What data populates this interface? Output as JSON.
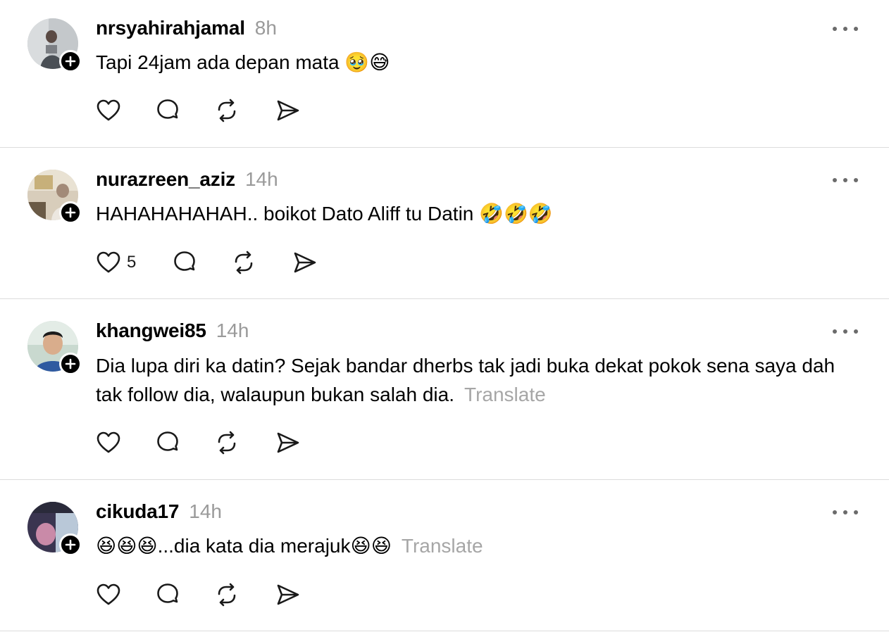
{
  "colors": {
    "text": "#000000",
    "muted": "#9a9a9a",
    "divider": "#dcdcdc",
    "badge": "#000000"
  },
  "icons": {
    "like": "heart-icon",
    "reply": "comment-bubble-icon",
    "repost": "repost-arrows-icon",
    "share": "send-paper-plane-icon",
    "more": "more-horizontal-icon",
    "follow": "plus-icon"
  },
  "posts": [
    {
      "username": "nrsyahirahjamal",
      "time": "8h",
      "text": "Tapi 24jam ada depan mata ",
      "emoji": "🥹😅",
      "translate": "",
      "like_count": ""
    },
    {
      "username": "nurazreen_aziz",
      "time": "14h",
      "text": "HAHAHAHAHAH.. boikot Dato Aliff tu Datin ",
      "emoji": "🤣🤣🤣",
      "translate": "",
      "like_count": "5"
    },
    {
      "username": "khangwei85",
      "time": "14h",
      "text": "Dia lupa diri ka datin? Sejak bandar dherbs tak jadi buka dekat pokok sena saya dah tak follow dia, walaupun bukan salah dia.",
      "emoji": "",
      "translate": "Translate",
      "like_count": ""
    },
    {
      "username": "cikuda17",
      "time": "14h",
      "text_emoji_lead": "😆😆😆",
      "text": "...dia kata dia merajuk",
      "emoji": "😆😆",
      "translate": "Translate",
      "like_count": ""
    }
  ]
}
